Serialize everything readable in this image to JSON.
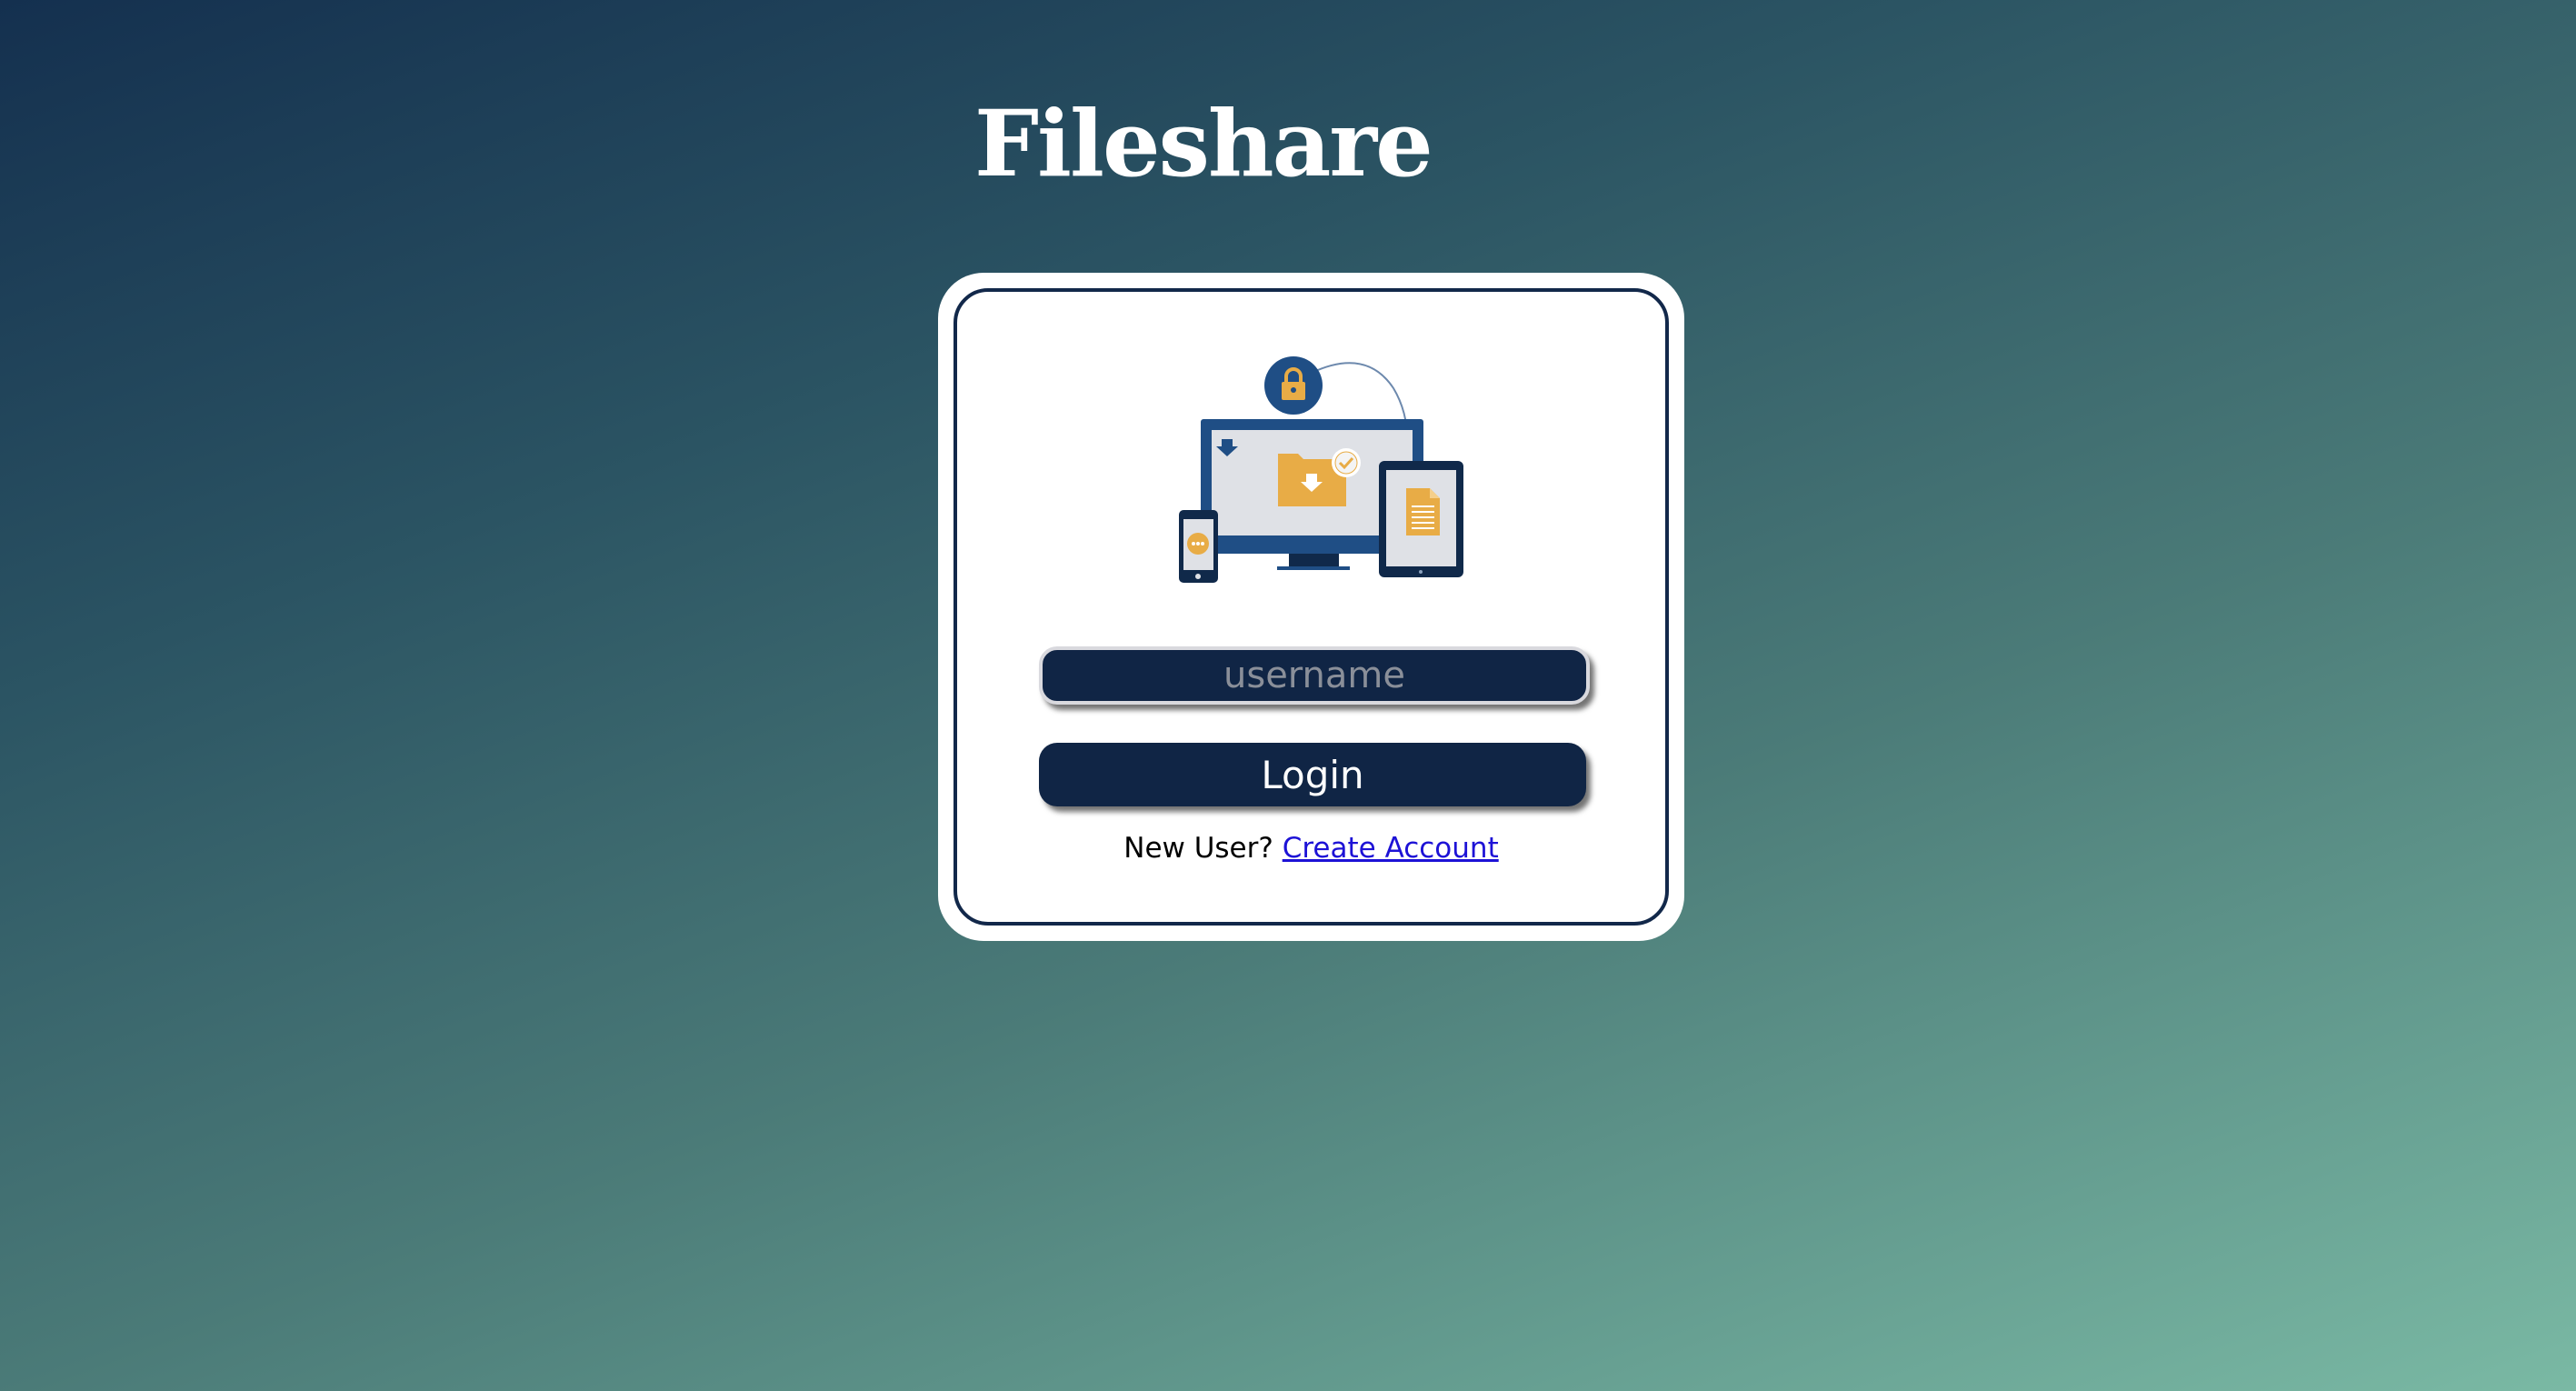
{
  "app": {
    "title": "Fileshare"
  },
  "illustration": {
    "icon": "devices-file-share-icon"
  },
  "form": {
    "username_placeholder": "username",
    "username_value": "",
    "login_label": "Login",
    "new_user_text": "New User?",
    "create_account_label": "Create Account"
  },
  "colors": {
    "accent_navy": "#102545",
    "illustration_blue": "#1f4e85",
    "illustration_orange": "#e8ac46",
    "link_blue": "#1d12d6"
  }
}
